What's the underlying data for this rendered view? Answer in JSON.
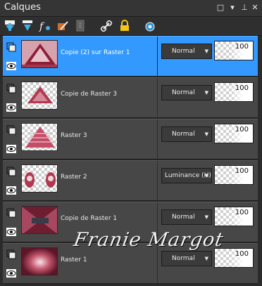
{
  "panel": {
    "title": "Calques",
    "controls": {
      "restore": "□",
      "menu": "▾",
      "pin": "⊥",
      "close": "✕"
    }
  },
  "toolbar": {
    "icons": [
      "new-raster-layer-icon",
      "new-vector-layer-icon",
      "new-adjustment-layer-icon",
      "new-mask-layer-icon",
      "new-group-icon",
      "link-icon",
      "lock-icon",
      "highlight-icon"
    ]
  },
  "layers": [
    {
      "name": "Copie (2) sur Raster 1",
      "blend_mode": "Normal",
      "opacity": "100",
      "selected": true
    },
    {
      "name": "Copie de Raster 3",
      "blend_mode": "Normal",
      "opacity": "100",
      "selected": false
    },
    {
      "name": "Raster 3",
      "blend_mode": "Normal",
      "opacity": "100",
      "selected": false
    },
    {
      "name": "Raster 2",
      "blend_mode": "Luminance (H)",
      "opacity": "100",
      "selected": false
    },
    {
      "name": "Copie de Raster 1",
      "blend_mode": "Normal",
      "opacity": "100",
      "selected": false
    },
    {
      "name": "Raster 1",
      "blend_mode": "Normal",
      "opacity": "100",
      "selected": false
    }
  ],
  "watermark": {
    "text": "Franie Margot"
  },
  "colors": {
    "selected": "#3399ff",
    "row": "#474747",
    "thumb_accent": "#b0394f"
  }
}
